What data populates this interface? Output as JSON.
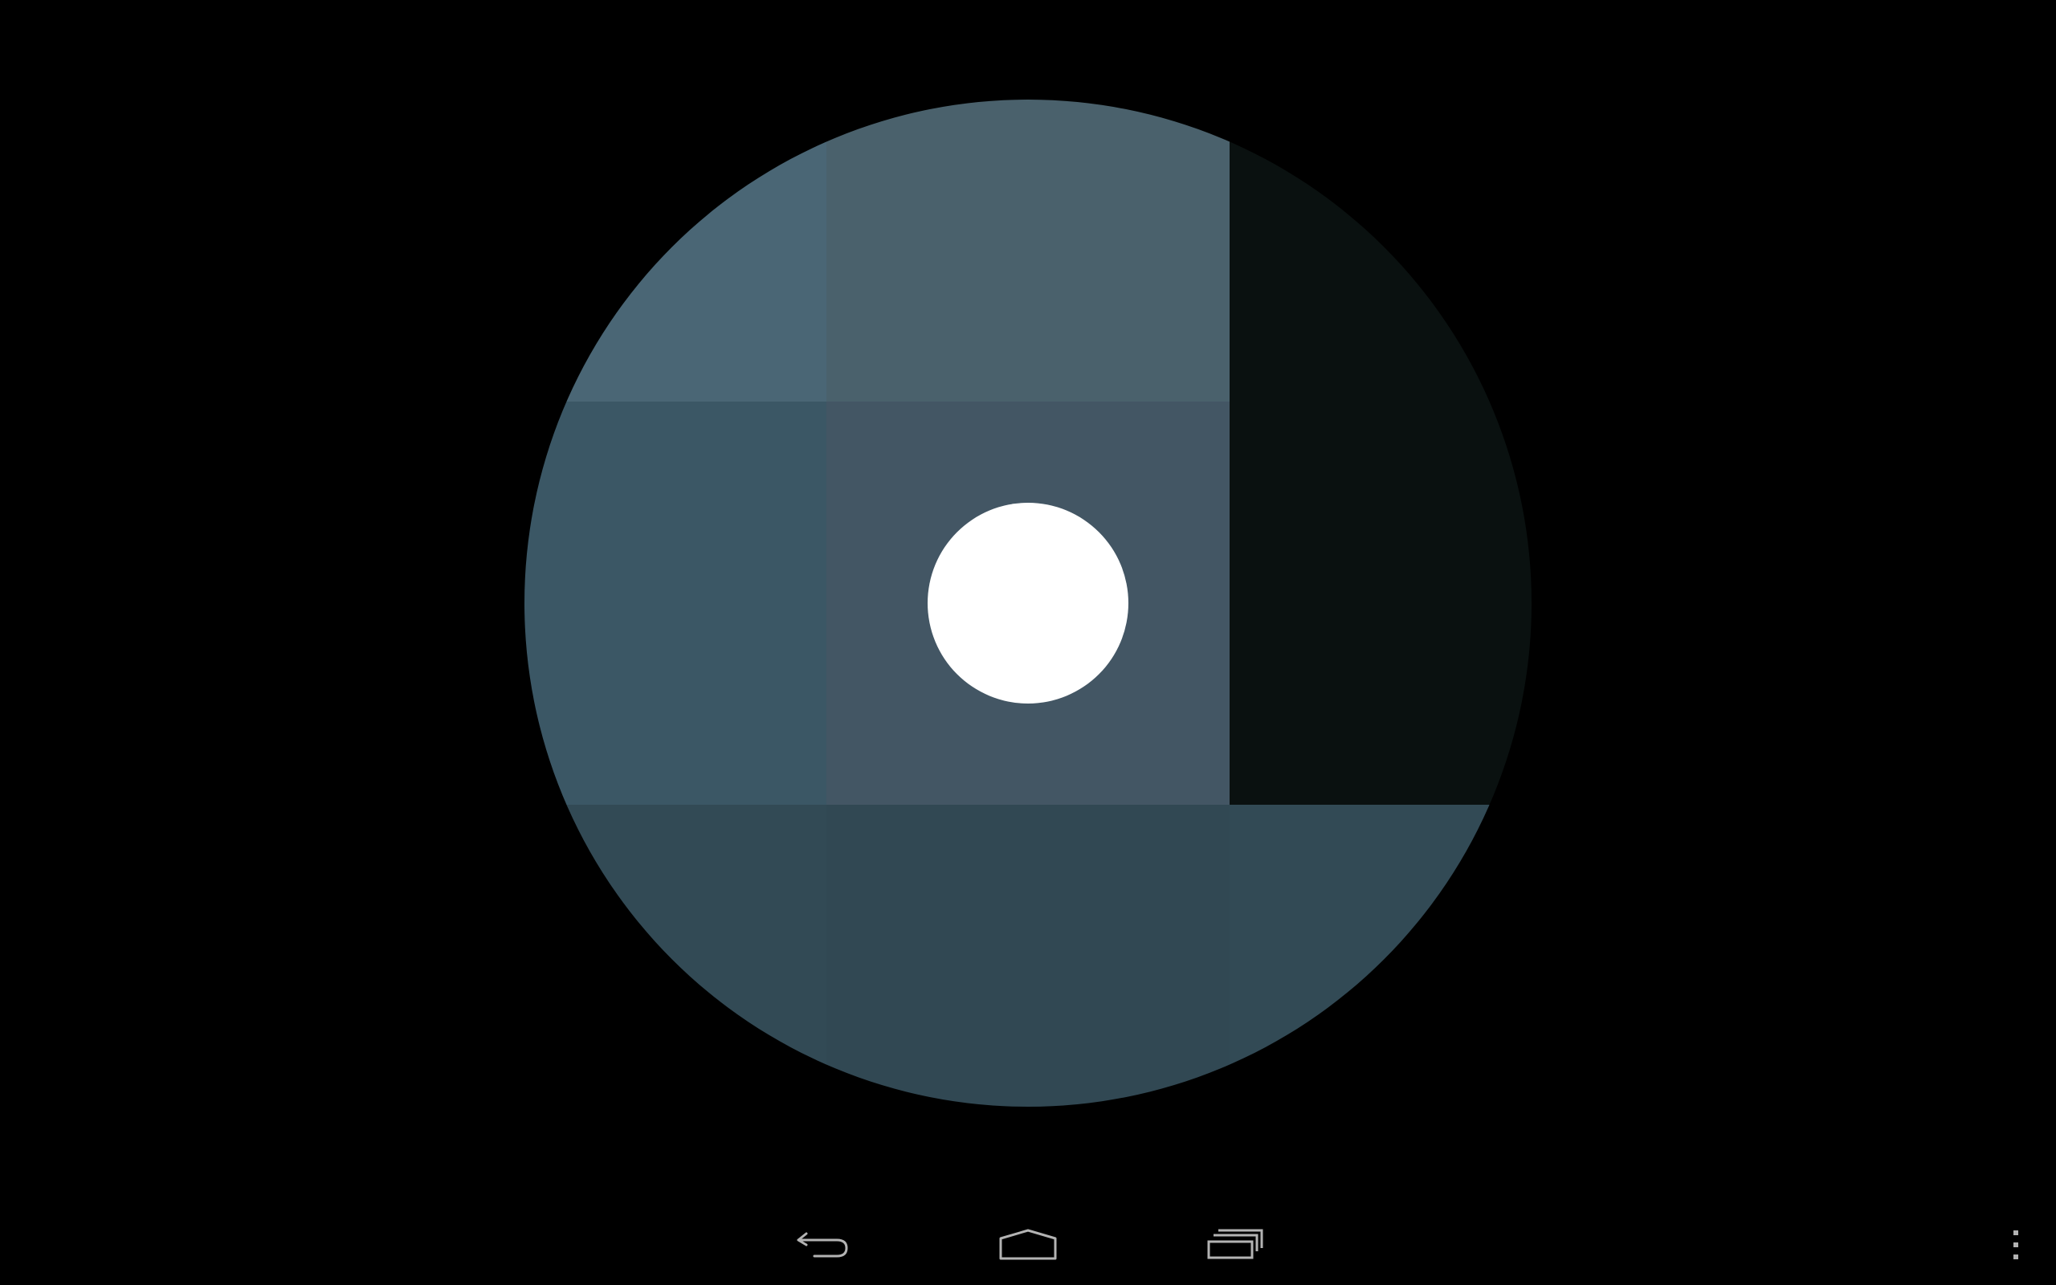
{
  "screen": {
    "background": "#000000"
  },
  "color_grid": {
    "rows": [
      [
        {
          "id": "r1c1",
          "color": "#4a6675"
        },
        {
          "id": "r1c2",
          "color": "#4a616c"
        },
        {
          "id": "r1c3",
          "color": "#0a1110"
        }
      ],
      [
        {
          "id": "r2c1",
          "color": "#3b5765"
        },
        {
          "id": "r2c2",
          "color": "#435664"
        },
        {
          "id": "r2c3",
          "color": "#0a1110"
        }
      ],
      [
        {
          "id": "r3c1",
          "color": "#324a55"
        },
        {
          "id": "r3c2",
          "color": "#314853"
        },
        {
          "id": "r3c3",
          "color": "#324a55"
        }
      ]
    ],
    "center_marker_color": "#ffffff"
  },
  "navigation_bar": {
    "buttons": [
      {
        "name": "back-button",
        "icon": "back-arrow-icon"
      },
      {
        "name": "home-button",
        "icon": "home-icon"
      },
      {
        "name": "recent-apps-button",
        "icon": "recent-apps-icon"
      },
      {
        "name": "overflow-menu-button",
        "icon": "overflow-menu-icon"
      }
    ],
    "icon_color": "#b3b3b3"
  }
}
